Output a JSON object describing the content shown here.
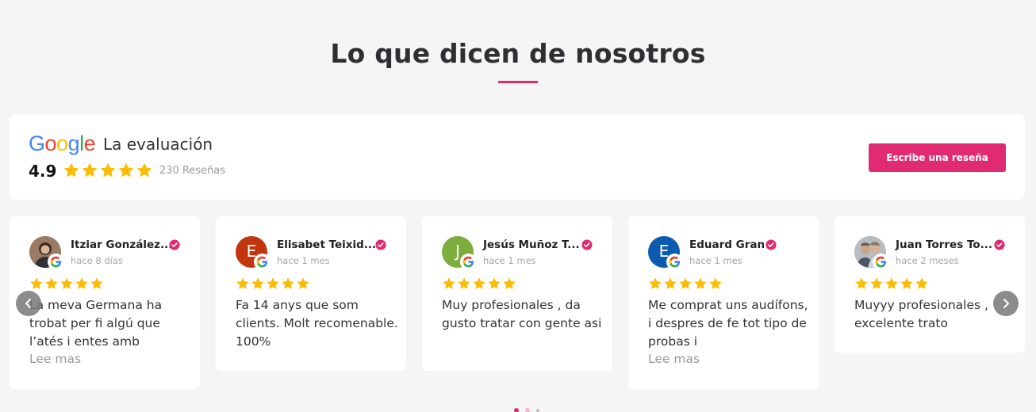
{
  "section": {
    "title": "Lo que dicen de nosotros"
  },
  "summary": {
    "google_logo": "Google",
    "evaluation_label": "La evaluación",
    "rating": "4.9",
    "stars": 5,
    "review_count": "230",
    "reviews_label": "Reseñas",
    "write_review_label": "Escribe una reseña"
  },
  "reviews": [
    {
      "name": "Itziar González...",
      "date": "hace 8 días",
      "stars": 5,
      "text": "La meva Germana ha trobat per fi algú que l’atés i entes amb",
      "read_more": "Lee mas",
      "avatar_letter": "",
      "avatar_color": "#8a6a55"
    },
    {
      "name": "Elisabet Teixid...",
      "date": "hace 1 mes",
      "stars": 5,
      "text": "Fa 14 anys que som clients. Molt recomenable. 100%",
      "read_more": "",
      "avatar_letter": "E",
      "avatar_color": "#c1360e"
    },
    {
      "name": "Jesús Muñoz T...",
      "date": "hace 1 mes",
      "stars": 5,
      "text": "Muy profesionales , da gusto tratar con gente asi",
      "read_more": "",
      "avatar_letter": "J",
      "avatar_color": "#7cae3d"
    },
    {
      "name": "Eduard Gran",
      "date": "hace 1 mes",
      "stars": 5,
      "text": "Me comprat uns audífons, i despres de fe tot tipo de probas i",
      "read_more": "Lee mas",
      "avatar_letter": "E",
      "avatar_color": "#0b5bb0"
    },
    {
      "name": "Juan Torres To...",
      "date": "hace 2 meses",
      "stars": 5,
      "text": "Muyyy profesionales , excelente trato",
      "read_more": "",
      "avatar_letter": "",
      "avatar_color": "#a7a7a7"
    }
  ],
  "carousel": {
    "pages": 3,
    "active_page": 1
  },
  "colors": {
    "accent": "#e02a72",
    "star": "#fbbc05",
    "background": "#f5f5f6"
  },
  "icons": [
    "google-logo",
    "star-icon",
    "verified-check-icon",
    "google-g-badge-icon",
    "chevron-left-icon",
    "chevron-right-icon"
  ]
}
